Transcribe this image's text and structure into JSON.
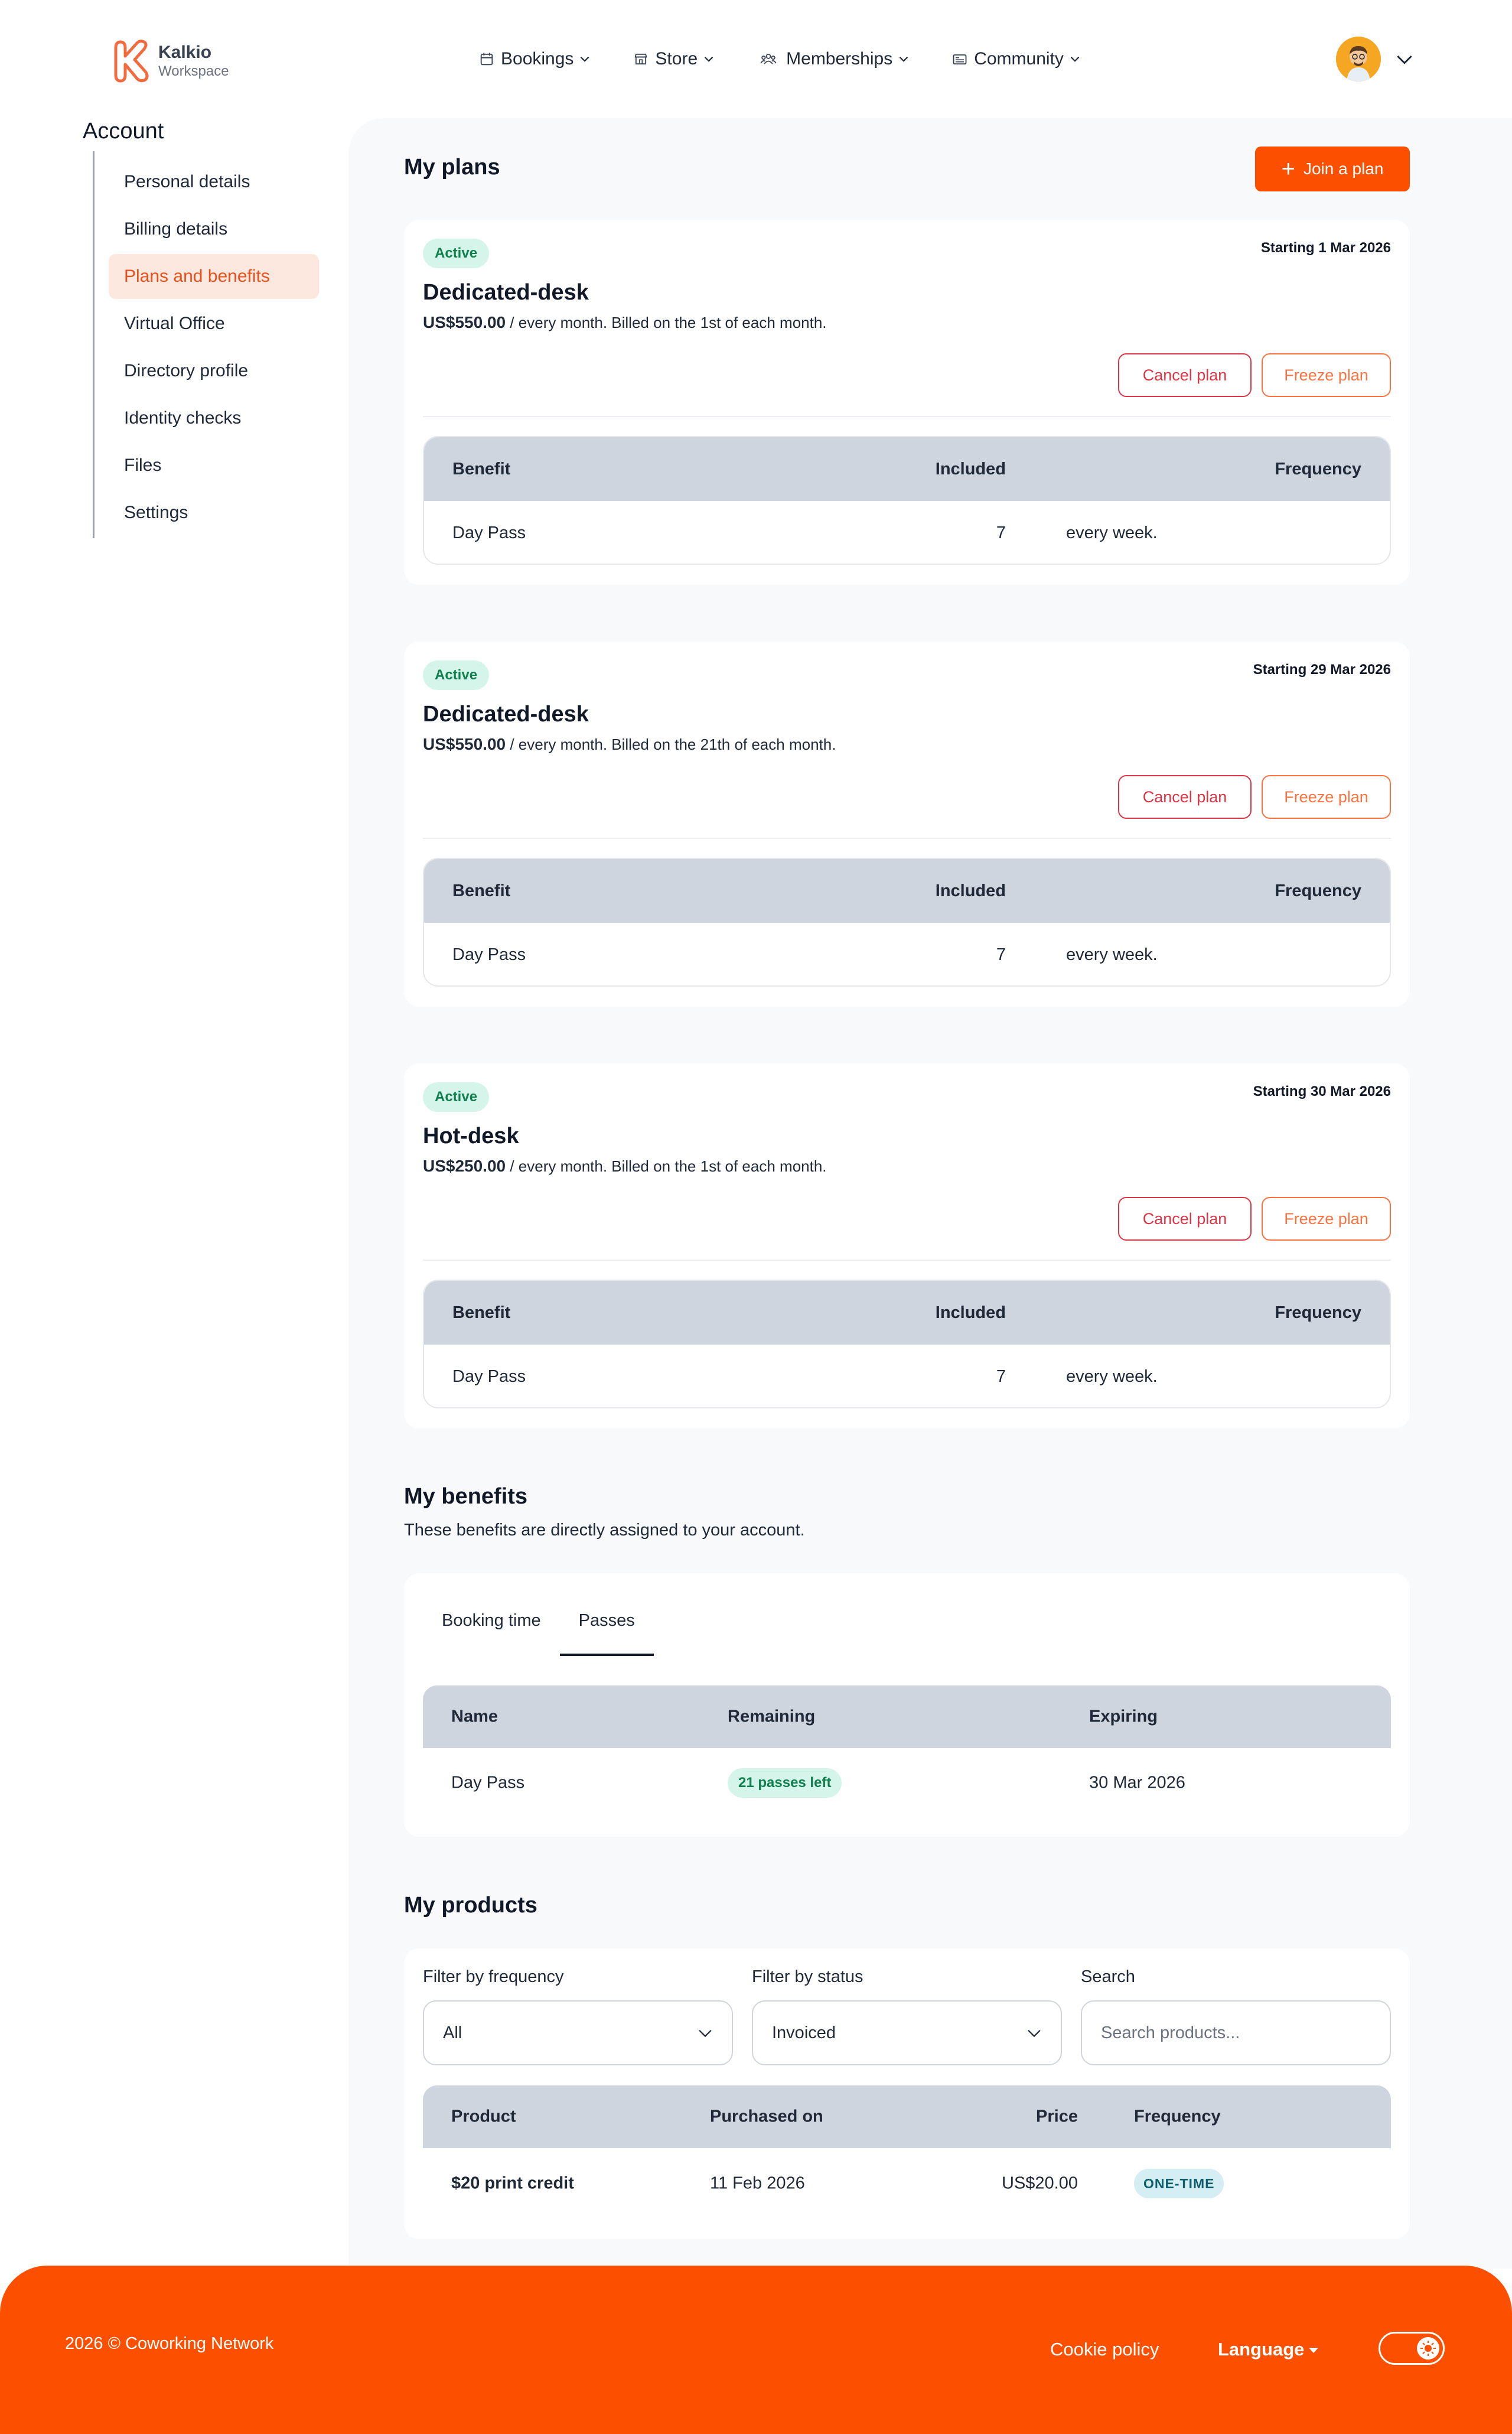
{
  "header": {
    "brand": "Kalkio",
    "brand_sub": "Workspace",
    "nav": [
      {
        "label": "Bookings",
        "icon": "calendar-icon"
      },
      {
        "label": "Store",
        "icon": "store-icon"
      },
      {
        "label": "Memberships",
        "icon": "users-icon"
      },
      {
        "label": "Community",
        "icon": "newspaper-icon"
      }
    ]
  },
  "sidebar": {
    "title": "Account",
    "items": [
      {
        "label": "Personal details"
      },
      {
        "label": "Billing details"
      },
      {
        "label": "Plans and benefits",
        "active": true
      },
      {
        "label": "Virtual Office"
      },
      {
        "label": "Directory profile"
      },
      {
        "label": "Identity checks"
      },
      {
        "label": "Files"
      },
      {
        "label": "Settings"
      }
    ]
  },
  "plans": {
    "title": "My plans",
    "join_label": "Join a plan",
    "cancel_label": "Cancel plan",
    "freeze_label": "Freeze plan",
    "table_headers": {
      "benefit": "Benefit",
      "included": "Included",
      "frequency": "Frequency"
    },
    "items": [
      {
        "status": "Active",
        "start": "Starting 1 Mar 2026",
        "name": "Dedicated-desk",
        "price": "US$550.00",
        "billing": " every month. Billed on the 1st of each month.",
        "benefits": [
          {
            "benefit": "Day Pass",
            "included": "7",
            "frequency": "every week."
          }
        ]
      },
      {
        "status": "Active",
        "start": "Starting 29 Mar 2026",
        "name": "Dedicated-desk",
        "price": "US$550.00",
        "billing": " every month. Billed on the 21th of each month.",
        "benefits": [
          {
            "benefit": "Day Pass",
            "included": "7",
            "frequency": "every week."
          }
        ]
      },
      {
        "status": "Active",
        "start": "Starting 30 Mar 2026",
        "name": "Hot-desk",
        "price": "US$250.00",
        "billing": " every month. Billed on the 1st of each month.",
        "benefits": [
          {
            "benefit": "Day Pass",
            "included": "7",
            "frequency": "every week."
          }
        ]
      }
    ]
  },
  "benefits": {
    "title": "My benefits",
    "subtitle": "These benefits are directly assigned to your account.",
    "tabs": [
      {
        "label": "Booking time"
      },
      {
        "label": "Passes",
        "active": true
      }
    ],
    "headers": {
      "name": "Name",
      "remaining": "Remaining",
      "expiring": "Expiring"
    },
    "rows": [
      {
        "name": "Day Pass",
        "remaining": "21 passes left",
        "expiring": "30 Mar 2026"
      }
    ]
  },
  "products": {
    "title": "My products",
    "filter_frequency_label": "Filter by frequency",
    "filter_frequency_value": "All",
    "filter_status_label": "Filter by status",
    "filter_status_value": "Invoiced",
    "search_label": "Search",
    "search_placeholder": "Search products...",
    "headers": {
      "product": "Product",
      "purchased": "Purchased on",
      "price": "Price",
      "frequency": "Frequency"
    },
    "rows": [
      {
        "product": "$20 print credit",
        "purchased": "11 Feb 2026",
        "price": "US$20.00",
        "frequency": "ONE-TIME"
      }
    ]
  },
  "footer": {
    "copyright": "2026 © Coworking Network",
    "cookie": "Cookie policy",
    "language": "Language"
  },
  "colors": {
    "accent": "#fc4f00",
    "active_badge_bg": "#d6f5ea",
    "table_head": "#cfd5de"
  }
}
